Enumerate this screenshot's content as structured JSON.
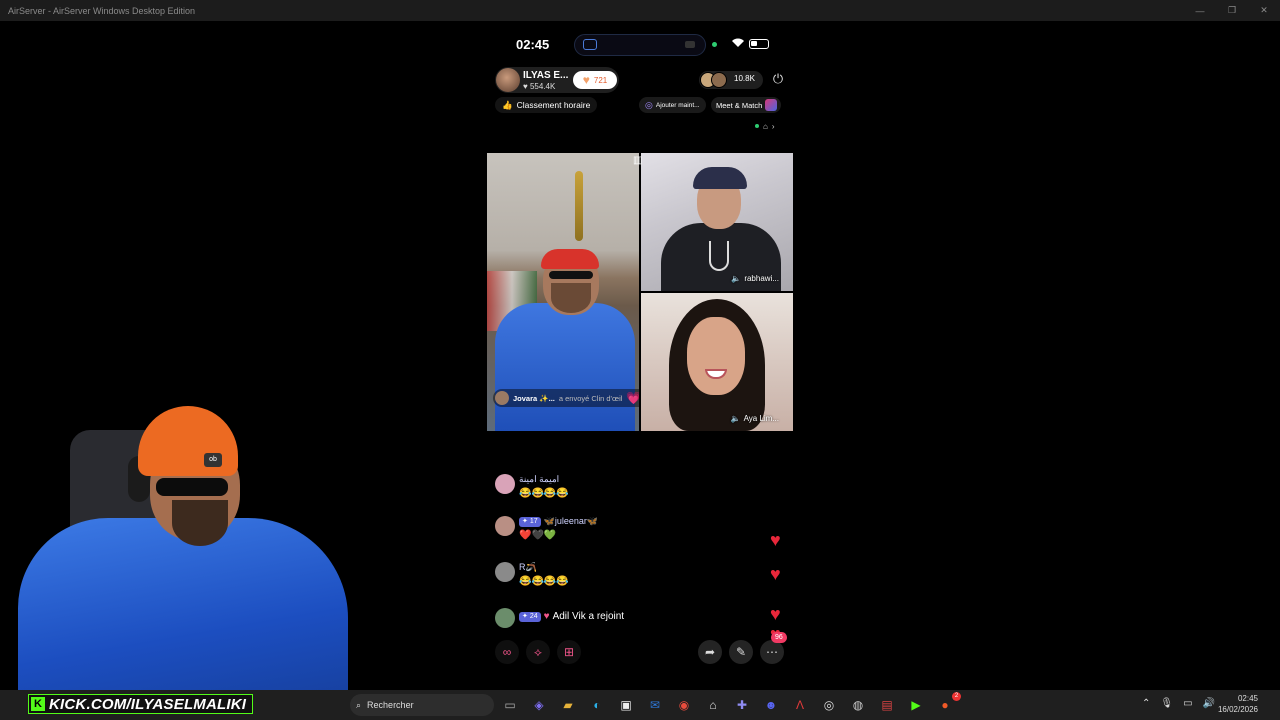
{
  "window": {
    "title": "AirServer - AirServer Windows Desktop Edition",
    "controls": [
      "—",
      "❐",
      "✕"
    ]
  },
  "phone": {
    "status": {
      "time": "02:45"
    },
    "host": {
      "name": "ILYAS E...",
      "likes": "554.4K",
      "gift_count": "721"
    },
    "viewers": {
      "count": "10.8K"
    },
    "pills": {
      "ranking": "Classement horaire",
      "add": "Ajouter maint...",
      "match": "Meet & Match"
    },
    "tiles": {
      "b_label": "rabhawi...",
      "c_label": "Aya Lim..."
    },
    "gift_banner": {
      "sender": "Jovara ✨...",
      "text": "a envoyé Clin d'œil",
      "multiplier": "× 1"
    },
    "chat": [
      {
        "user": "اميمة امينة",
        "text": "😂😂😂😂",
        "badge": ""
      },
      {
        "user": "🦋juleenar🦋",
        "text": "❤️🖤💚",
        "badge": "17"
      },
      {
        "user": "R🪃",
        "text": "😂😂😂😂",
        "badge": ""
      },
      {
        "user": "Adil Vik a rejoint",
        "text": "",
        "badge": "24"
      }
    ],
    "actions": {
      "notification": "96"
    }
  },
  "overlay": {
    "kick_url": "KICK.COM/ILYASELMALIKI",
    "beanie_logo": "ob"
  },
  "taskbar": {
    "search_placeholder": "Rechercher",
    "time": "02:45",
    "date": "16/02/2026",
    "badge_a": "2"
  },
  "colors": {
    "accent_green": "#53fc18",
    "heart_red": "#e8273a",
    "pink": "#f0558a"
  }
}
